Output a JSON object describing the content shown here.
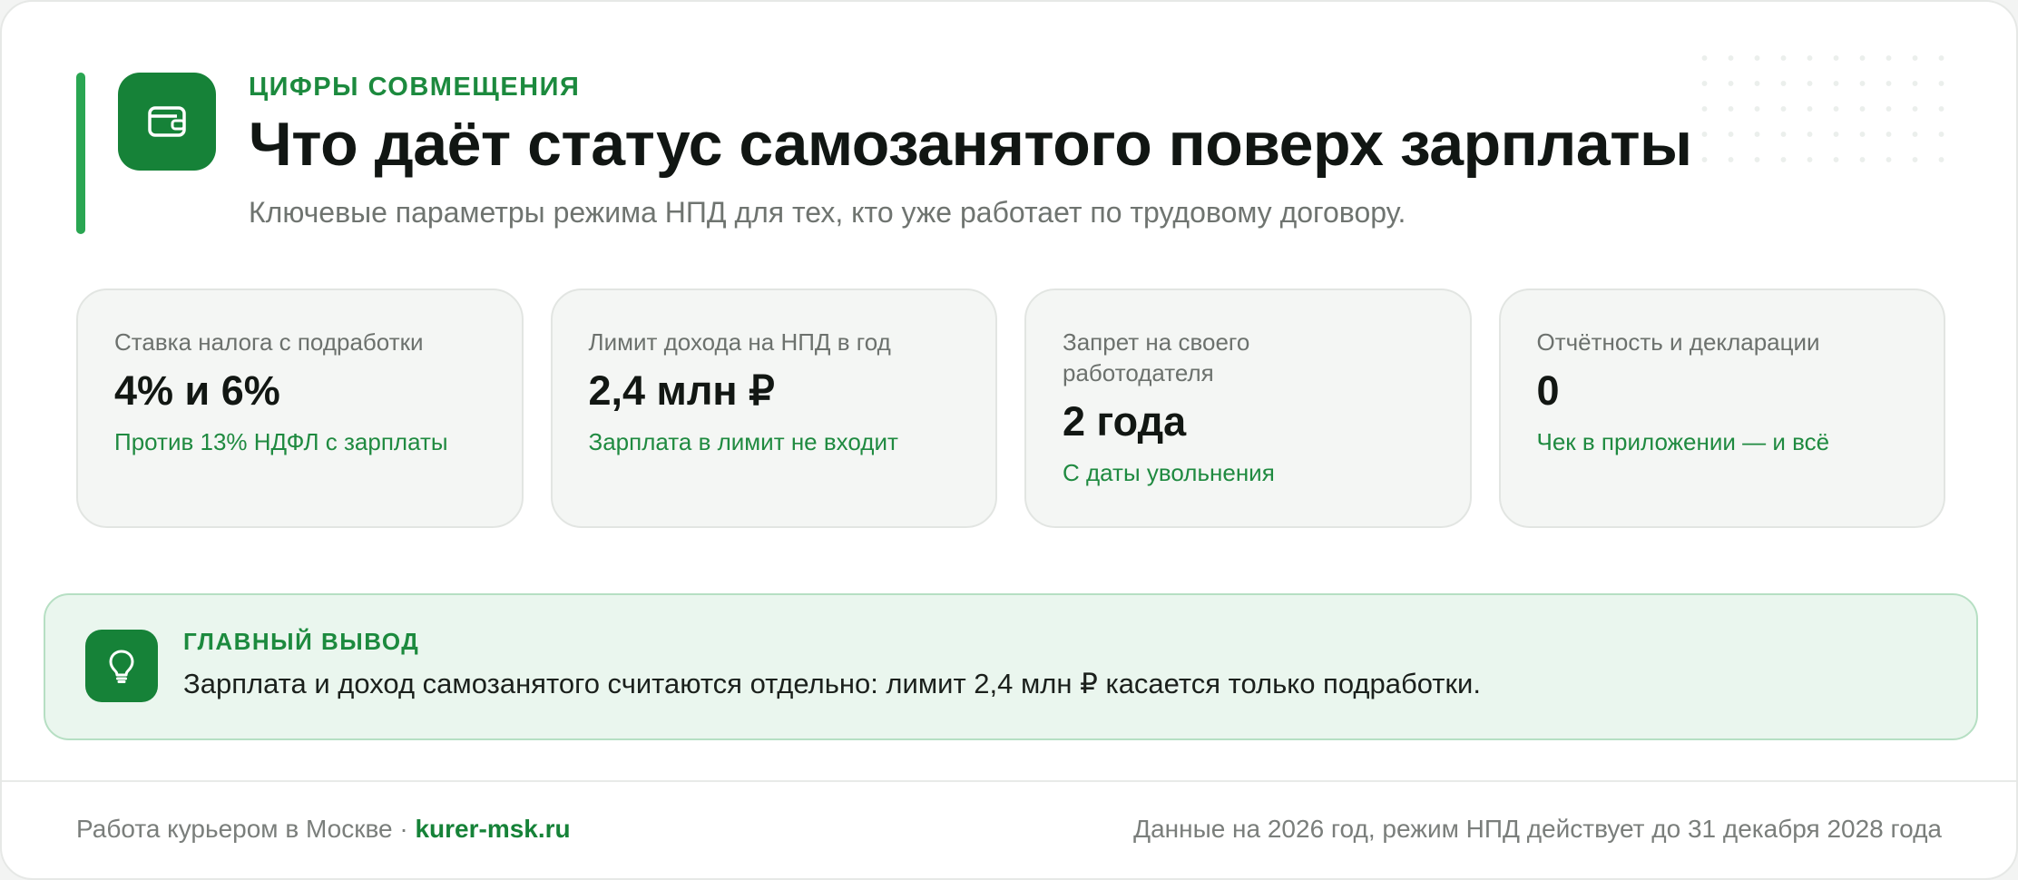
{
  "header": {
    "eyebrow": "ЦИФРЫ СОВМЕЩЕНИЯ",
    "title": "Что даёт статус самозанятого поверх зарплаты",
    "subtitle": "Ключевые параметры режима НПД для тех, кто уже работает по трудовому договору.",
    "logo_icon": "wallet-icon"
  },
  "cards": [
    {
      "label": "Ставка налога с подработки",
      "value": "4% и 6%",
      "note": "Против 13% НДФЛ с зарплаты"
    },
    {
      "label": "Лимит дохода на НПД в год",
      "value": "2,4 млн ₽",
      "note": "Зарплата в лимит не входит"
    },
    {
      "label": "Запрет на своего работодателя",
      "value": "2 года",
      "note": "С даты увольнения"
    },
    {
      "label": "Отчётность и декларации",
      "value": "0",
      "note": "Чек в приложении — и всё"
    }
  ],
  "callout": {
    "icon": "lightbulb-icon",
    "title": "ГЛАВНЫЙ ВЫВОД",
    "text": "Зарплата и доход самозанятого считаются отдельно: лимит 2,4 млн ₽ касается только подработки."
  },
  "footer": {
    "left_text": "Работа курьером в Москве · ",
    "brand": "kurer-msk.ru",
    "right_text": "Данные на 2026 год, режим НПД действует до 31 декабря 2028 года"
  },
  "colors": {
    "accent_green": "#168238",
    "accent_bar": "#2aa652",
    "text_dark": "#111613",
    "text_muted": "#6f7470",
    "callout_bg": "#eaf6ee"
  }
}
